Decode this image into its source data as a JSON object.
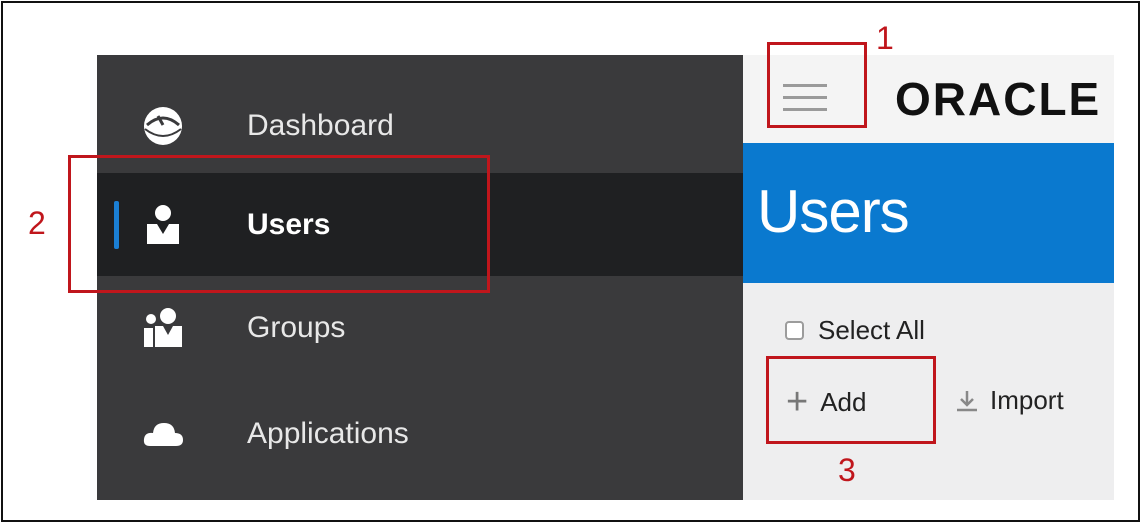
{
  "sidebar": {
    "items": [
      {
        "label": "Dashboard",
        "icon": "dashboard-gauge-icon"
      },
      {
        "label": "Users",
        "icon": "user-icon",
        "active": true
      },
      {
        "label": "Groups",
        "icon": "groups-icon"
      },
      {
        "label": "Applications",
        "icon": "cloud-icon"
      }
    ]
  },
  "header": {
    "logo_text": "ORACLE",
    "menu_icon": "hamburger-menu-icon"
  },
  "page": {
    "title": "Users"
  },
  "toolbar": {
    "select_all_label": "Select All",
    "add_label": "Add",
    "import_label": "Import"
  },
  "annotations": {
    "one": "1",
    "two": "2",
    "three": "3"
  },
  "colors": {
    "sidebar_bg": "#3a3a3c",
    "sidebar_active_bg": "#1f2022",
    "active_indicator": "#1b7fd4",
    "hero_bg": "#0a79cf",
    "annotation_red": "#c0161c"
  }
}
